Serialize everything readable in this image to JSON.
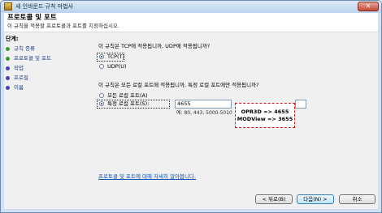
{
  "window": {
    "title": "새 인바운드 규칙 마법사",
    "close_label": "✕"
  },
  "header": {
    "title": "프로토콜 및 포트",
    "subtitle": "이 규칙을 적용할 프로토콜과 포트를 지정하십시오."
  },
  "sidebar": {
    "steps_label": "단계:",
    "items": [
      {
        "label": "규칙 종류",
        "color": "green"
      },
      {
        "label": "프로토콜 및 포트",
        "color": "green"
      },
      {
        "label": "작업",
        "color": "purple"
      },
      {
        "label": "프로필",
        "color": "purple"
      },
      {
        "label": "이름",
        "color": "purple"
      }
    ]
  },
  "protocol": {
    "question": "이 규칙은 TCP에 적용됩니까, UDP에 적용됩니까?",
    "tcp_label": "TCP(T)",
    "udp_label": "UDP(U)",
    "selected": "TCP"
  },
  "ports": {
    "question": "이 규칙은 모든 로컬 포트에 적용됩니까, 특정 로컬 포트에만 적용됩니까?",
    "all_label": "모든 로컬 포트(A)",
    "specific_label": "특정 로컬 포트(S):",
    "selected": "specific",
    "value": "4655",
    "example": "예: 80, 443, 5000-5010"
  },
  "callout": {
    "line1": "OPR3D => 4655",
    "line2": "MODView => 3655"
  },
  "help_link": "프로토콜 및 포트에 대해 자세히 알아봅니다.",
  "buttons": {
    "back": "< 뒤로(B)",
    "next": "다음(N) >",
    "cancel": "취소"
  }
}
